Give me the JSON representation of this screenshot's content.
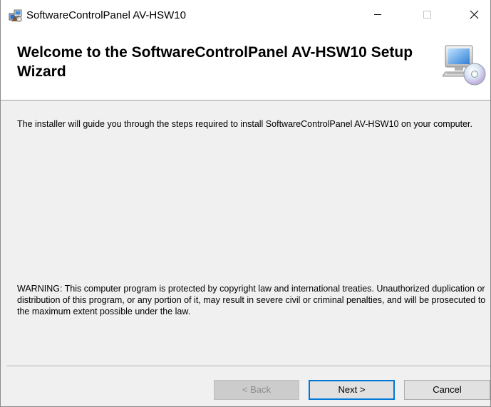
{
  "window": {
    "title": "SoftwareControlPanel AV-HSW10",
    "controls": {
      "minimize_icon": "minimize-icon",
      "maximize_icon": "maximize-icon",
      "close_icon": "close-icon"
    }
  },
  "banner": {
    "title": "Welcome to the SoftwareControlPanel AV-HSW10 Setup Wizard",
    "icon": "computer-cd-icon"
  },
  "content": {
    "intro": "The installer will guide you through the steps required to install SoftwareControlPanel AV-HSW10 on your computer.",
    "warning": "WARNING: This computer program is protected by copyright law and international treaties. Unauthorized duplication or distribution of this program, or any portion of it, may result in severe civil or criminal penalties, and will be prosecuted to the maximum extent possible under the law."
  },
  "buttons": {
    "back": "< Back",
    "next": "Next >",
    "cancel": "Cancel",
    "back_enabled": false,
    "default_button": "next"
  },
  "colors": {
    "accent": "#0078d7",
    "dialog_bg": "#f0f0f0",
    "banner_bg": "#ffffff"
  }
}
